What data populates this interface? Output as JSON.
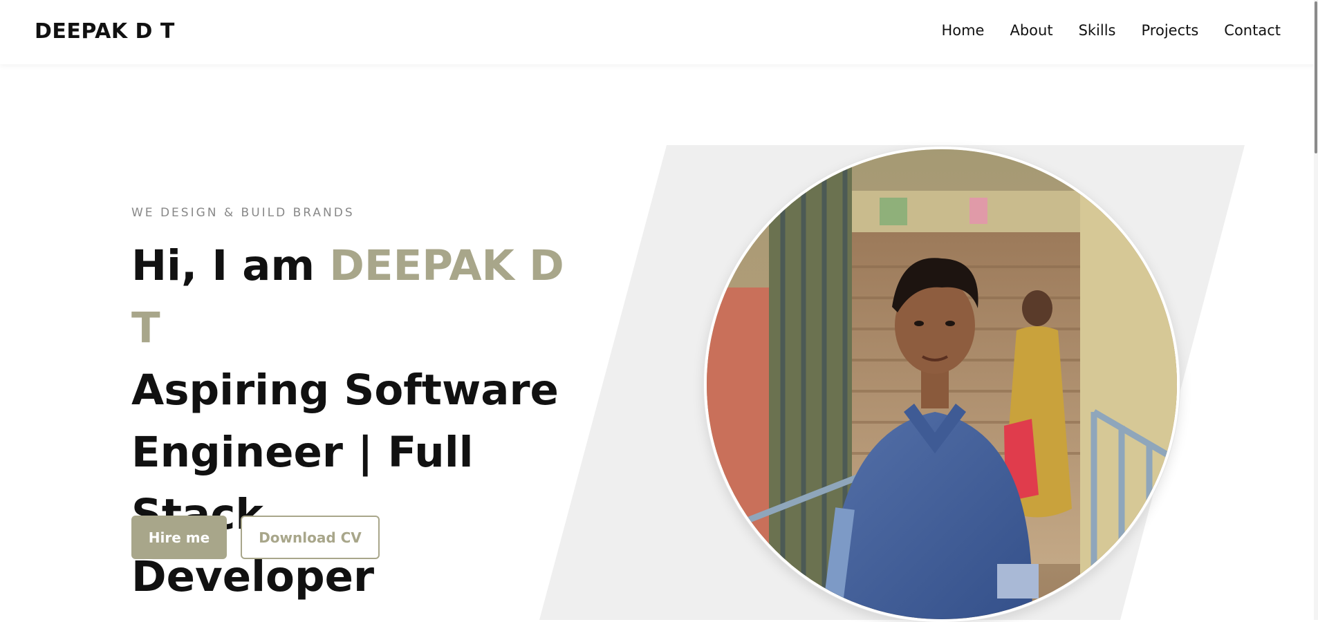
{
  "header": {
    "brand": "DEEPAK D T",
    "nav": [
      {
        "label": "Home"
      },
      {
        "label": "About"
      },
      {
        "label": "Skills"
      },
      {
        "label": "Projects"
      },
      {
        "label": "Contact"
      }
    ]
  },
  "hero": {
    "tagline": "WE DESIGN & BUILD BRANDS",
    "greeting": "Hi, I am ",
    "name": "DEEPAK D T",
    "title_line1": "Aspiring Software",
    "title_line2": "Engineer | Full Stack",
    "title_line3": "Developer",
    "hire_label": "Hire me",
    "download_label": "Download CV"
  },
  "colors": {
    "accent": "#a8a68a",
    "text": "#111111",
    "muted": "#888888",
    "panel": "#efefef"
  },
  "icons": {
    "profile_photo": "profile-photo"
  }
}
